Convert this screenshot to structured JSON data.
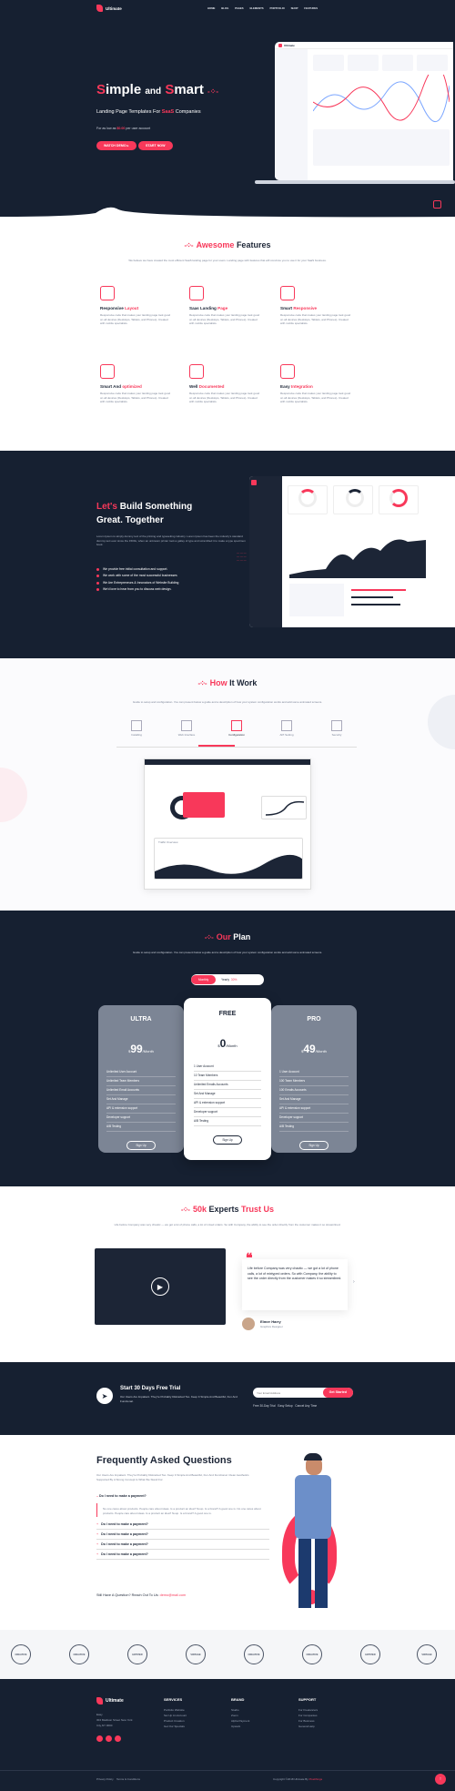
{
  "brand": {
    "name": "Ultimate",
    "accent": "#f8385a",
    "dark": "#162031"
  },
  "nav": {
    "items": [
      "HOME",
      "BLOG",
      "PAGES",
      "ELEMENTS",
      "PORTFOLIO",
      "SHOP",
      "FEATURES"
    ]
  },
  "hero": {
    "title_a": "imple",
    "title_b": "and",
    "title_c": "mart",
    "title_s": "S",
    "title_s2": "S",
    "subtitle_a": "Landing Page Templates For",
    "subtitle_b": "SaaS",
    "subtitle_c": "Companies",
    "price_a": "For as low as",
    "price_b": "$0.00",
    "price_c": "per user account",
    "btn1": "WATCH DEMO",
    "btn2": "START NOW"
  },
  "dashboard": {
    "brand": "Ultimate"
  },
  "features": {
    "title_a": "Awesome",
    "title_b": "Features",
    "intro": "We believe we have created the most efficient SaaS landing page for your users. Landing page with features that will convince you to use it for your SaaS business.",
    "items": [
      {
        "t1": "Responsive",
        "t2": "Layout",
        "d": "Responsive code that makes your landing page look good on all devices (Desktops, Tablets, and Phones). Created with mobile specialists."
      },
      {
        "t1": "Saas Landing",
        "t2": "Page",
        "d": "Responsive code that makes your landing page look good on all devices (Desktops, Tablets, and Phones). Created with mobile specialists."
      },
      {
        "t1": "Smart",
        "t2": "Responsive",
        "d": "Responsive code that makes your landing page look good on all devices (Desktops, Tablets, and Phones). Created with mobile specialists."
      },
      {
        "t1": "Smart And",
        "t2": "optimized",
        "d": "Responsive code that makes your landing page look good on all devices (Desktops, Tablets, and Phones). Created with mobile specialists."
      },
      {
        "t1": "Well",
        "t2": "Documented",
        "d": "Responsive code that makes your landing page look good on all devices (Desktops, Tablets, and Phones). Created with mobile specialists."
      },
      {
        "t1": "Easy",
        "t2": "Integration",
        "d": "Responsive code that makes your landing page look good on all devices (Desktops, Tablets, and Phones). Created with mobile specialists."
      }
    ]
  },
  "build": {
    "title_a": "Let's",
    "title_b": "Build Something",
    "title_c": "Great. Together",
    "desc": "Lorem Ipsum is simply dummy text of the printing and typesetting industry. Lorem Ipsum has been the industry's standard dummy text ever since the 1500s, when an unknown printer took a galley of type and scrambled it to make a type specimen book.",
    "bullets": [
      "We provide free initial consultation and support.",
      "We work with some of the most successful businesses",
      "We Are Entrepreneurs & Innovators of Website Building",
      "We'd love to hear from you to discuss web design."
    ]
  },
  "how": {
    "title_a": "How",
    "title_b": "It Work",
    "intro": "Guide to setup and configuration. You can present below a guide and a description of how your system configuration works and add some animated screens.",
    "steps": [
      "Installing",
      "Web Interface",
      "Configuration",
      "API Setting",
      "Security"
    ],
    "mock_label": "Traffic Overview"
  },
  "plan": {
    "title_a": "Our",
    "title_b": "Plan",
    "intro": "Guide to setup and configuration. You can present below a guide and a description of how your system configuration works and add some animated screens.",
    "toggle_a": "Monthly",
    "toggle_b": "Yearly",
    "toggle_c": "30%",
    "cards": [
      {
        "name": "ULTRA",
        "cur": "$",
        "price": "99",
        "per": "/Month",
        "items": [
          "Unlimited User Account",
          "Unlimited Team Members",
          "Unlimited Email Accounts",
          "Set And Manage",
          "API & extension support",
          "Developer support",
          "A/B Testing"
        ],
        "btn": "Sign Up"
      },
      {
        "name": "FREE",
        "cur": "$",
        "price": "0",
        "per": "/Month",
        "items": [
          "1 User Account",
          "10 Team Members",
          "Unlimited Emails Accounts",
          "Set And Manage",
          "API & extension support",
          "Developer support",
          "A/B Testing"
        ],
        "btn": "Sign Up"
      },
      {
        "name": "PRO",
        "cur": "$",
        "price": "49",
        "per": "/Month",
        "items": [
          "1 User Account",
          "100 Team Members",
          "100 Emails Accounts",
          "Set And Manage",
          "API & extension support",
          "Developer support",
          "A/B Testing"
        ],
        "btn": "Sign Up"
      }
    ]
  },
  "trust": {
    "title_a": "50k",
    "title_b": "Experts",
    "title_c": "Trust Us",
    "intro": "Life before Company was very chaotic — we got a lot of phone calls, a lot of mixed orders. So with Company, the ability to see the order directly from the customer makes it so streamlined.",
    "quote": "Life before Company was very chaotic — we got a lot of phone calls, a lot of mixtyped orders. So with Company, the ability to see the order directly from the customer makes it so streamlined.",
    "name": "Elmer Harry",
    "role": "Graphics Designer"
  },
  "trial": {
    "title": "Start 30 Days Free Trial",
    "desc": "Our Users Are Impatient. They're Probably Distracted Too. Keep It Simple And Beautiful, Fun And Functional.",
    "placeholder": "Your Email Address",
    "btn": "Get Started",
    "notes": [
      "Free 30-Day Trial",
      "Easy Setup",
      "Cancel Any Time"
    ]
  },
  "faq": {
    "title": "Frequently Asked Questions",
    "intro": "Our Users Are Impatient. They're Probably Distracted Too. Keep It Simple And Beautiful, Fun And Functional. Clean Aesthetics Supported By A Strong Concept Is What We Stand For.",
    "open_q": "Do I need to make a payment?",
    "open_a": "No one cares about products. People care about ideas. Is a product an idea? Noup. Is a brand? A good one is. No one cares about products. People care about ideas. Is a product an idea? Noup. Is a brand? A good one is.",
    "questions": [
      "Do I need to make a payment?",
      "Do I need to make a payment?",
      "Do I need to make a payment?",
      "Do I need to make a payment?"
    ],
    "contact_a": "Still Have A Question? Reach Out To Us:",
    "contact_b": "demo@mail.com"
  },
  "logos": [
    "CREATIVE",
    "CREATIVE",
    "HIPSTER",
    "VINTAGE",
    "CREATIVE",
    "CREATIVE",
    "HIPSTER",
    "VINTAGE"
  ],
  "footer": {
    "brand": "Ultimate",
    "addr": [
      "Easy",
      "304 Madison Street New York",
      "City,NY 0000"
    ],
    "cols": [
      {
        "h": "SERVICES",
        "items": [
          "Portfolio Website",
          "Set Up An Account",
          "Product Creation",
          "Get Our Specials"
        ]
      },
      {
        "h": "BRAND",
        "items": [
          "Studio",
          "Zoom",
          "Alpha Payment",
          "Upwork"
        ]
      },
      {
        "h": "SUPPORT",
        "items": [
          "For Freelancers",
          "For Companies",
          "For Business",
          "General Help"
        ]
      }
    ],
    "links": [
      "Privacy Policy",
      "Terms & Conditions"
    ],
    "copy": "Copyright ©2018 Ultimate By",
    "copy_b": "Pixelthings"
  }
}
